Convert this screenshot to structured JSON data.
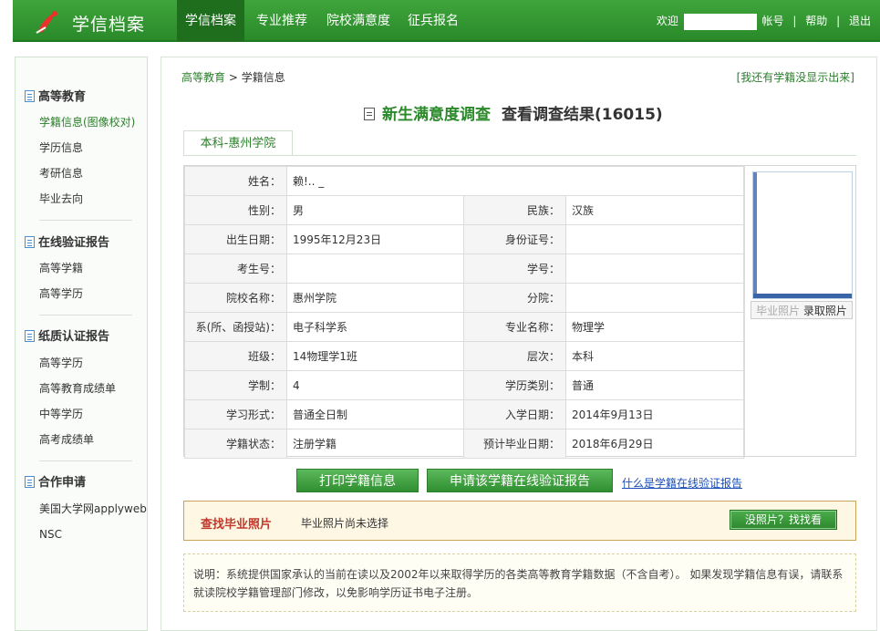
{
  "header": {
    "logo_text": "学信档案",
    "nav": [
      {
        "label": "学信档案",
        "active": true
      },
      {
        "label": "专业推荐",
        "active": false
      },
      {
        "label": "院校满意度",
        "active": false
      },
      {
        "label": "征兵报名",
        "active": false
      }
    ],
    "welcome": "欢迎",
    "username": "",
    "account": "帐号",
    "help": "帮助",
    "logout": "退出"
  },
  "sidebar": {
    "sections": [
      {
        "title": "高等教育",
        "items": [
          "学籍信息(图像校对)",
          "学历信息",
          "考研信息",
          "毕业去向"
        ]
      },
      {
        "title": "在线验证报告",
        "items": [
          "高等学籍",
          "高等学历"
        ]
      },
      {
        "title": "纸质认证报告",
        "items": [
          "高等学历",
          "高等教育成绩单",
          "中等学历",
          "高考成绩单"
        ]
      },
      {
        "title": "合作申请",
        "items": [
          "美国大学网applyweb",
          "NSC"
        ]
      }
    ]
  },
  "main": {
    "breadcrumb": {
      "home": "高等教育",
      "separator": ">",
      "current": "学籍信息"
    },
    "no_record_link": "[我还有学籍没显示出来]",
    "survey_link": "新生满意度调查",
    "survey_result": "查看调查结果(16015)",
    "tab": "本科-惠州学院",
    "fields": {
      "name": {
        "label": "姓名：",
        "value": "赖!.. _"
      },
      "gender": {
        "label": "性别：",
        "value": "男"
      },
      "ethnicity": {
        "label": "民族：",
        "value": "汉族"
      },
      "birth": {
        "label": "出生日期：",
        "value": "1995年12月23日"
      },
      "id_no": {
        "label": "身份证号：",
        "value": ""
      },
      "exam_no": {
        "label": "考生号：",
        "value": ""
      },
      "student_no": {
        "label": "学号：",
        "value": ""
      },
      "school": {
        "label": "院校名称：",
        "value": "惠州学院"
      },
      "branch": {
        "label": "分院：",
        "value": ""
      },
      "department": {
        "label": "系(所、函授站)：",
        "value": "电子科学系"
      },
      "major": {
        "label": "专业名称：",
        "value": "物理学"
      },
      "class": {
        "label": "班级：",
        "value": "14物理学1班"
      },
      "level": {
        "label": "层次：",
        "value": "本科"
      },
      "duration": {
        "label": "学制：",
        "value": "4"
      },
      "degree_type": {
        "label": "学历类别：",
        "value": "普通"
      },
      "study_form": {
        "label": "学习形式：",
        "value": "普通全日制"
      },
      "enroll_date": {
        "label": "入学日期：",
        "value": "2014年9月13日"
      },
      "status": {
        "label": "学籍状态：",
        "value": "注册学籍"
      },
      "grad_date": {
        "label": "预计毕业日期：",
        "value": "2018年6月29日"
      }
    },
    "photo": {
      "graduation_label": "毕业照片",
      "admission_label": "录取照片"
    },
    "buttons": {
      "print": "打印学籍信息",
      "apply_report": "申请该学籍在线验证报告",
      "what_is": "什么是学籍在线验证报告"
    },
    "find_photo": {
      "title": "查找毕业照片",
      "status": "毕业照片尚未选择",
      "button": "没照片？找找看"
    },
    "note": "说明：系统提供国家承认的当前在读以及2002年以来取得学历的各类高等教育学籍数据（不含自考）。 如果发现学籍信息有误，请联系就读院校学籍管理部门修改，以免影响学历证书电子注册。"
  },
  "colors": {
    "brand_green": "#2a8a2a",
    "status_red": "#d40000",
    "link_blue": "#1b4fb6"
  }
}
